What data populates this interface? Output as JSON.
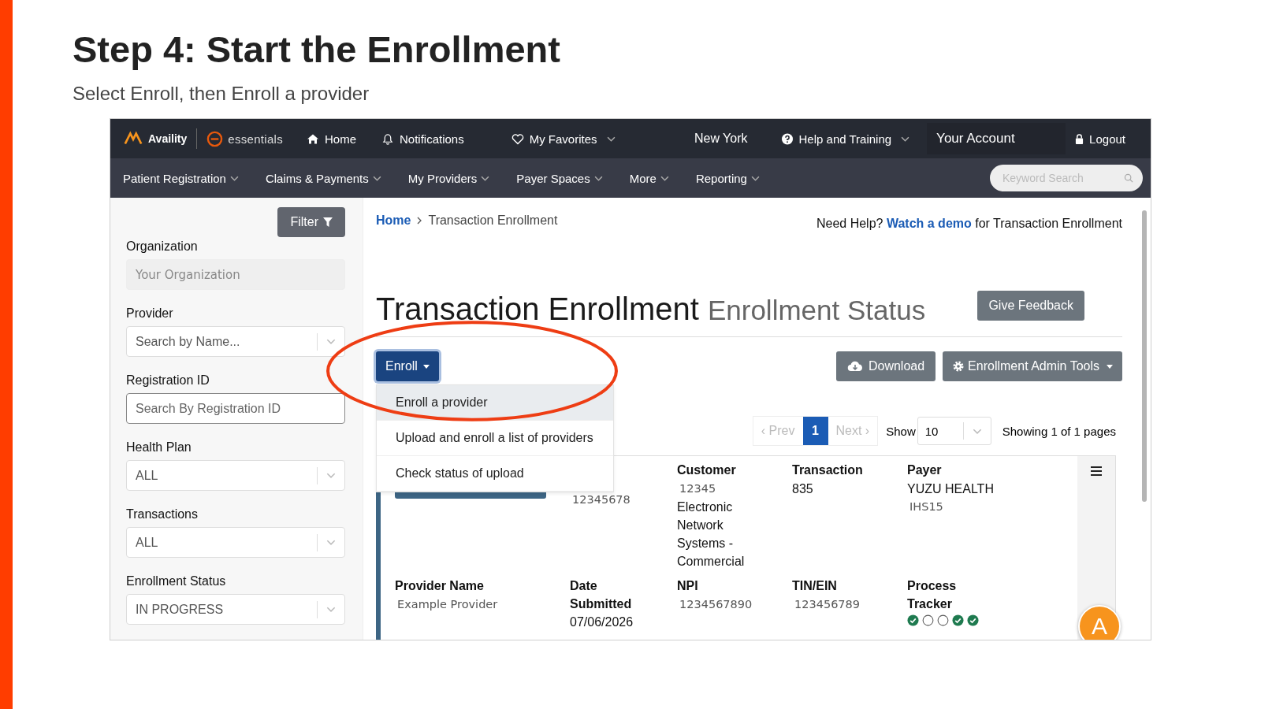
{
  "slide": {
    "title": "Step 4: Start the Enrollment",
    "subtitle": "Select Enroll, then Enroll a provider"
  },
  "topnav": {
    "brand": "Availity",
    "product": "essentials",
    "home": "Home",
    "notifications": "Notifications",
    "favorites": "My Favorites",
    "location": "New York",
    "help": "Help and Training",
    "account": "Your Account",
    "logout": "Logout"
  },
  "menu": {
    "items": [
      {
        "label": "Patient Registration"
      },
      {
        "label": "Claims & Payments"
      },
      {
        "label": "My Providers"
      },
      {
        "label": "Payer Spaces"
      },
      {
        "label": "More"
      },
      {
        "label": "Reporting"
      }
    ],
    "search_placeholder": "Keyword Search"
  },
  "sidebar": {
    "filter_button": "Filter",
    "fields": [
      {
        "label": "Organization",
        "kind": "readonly",
        "value": "Your Organization"
      },
      {
        "label": "Provider",
        "kind": "select",
        "placeholder": "Search by Name..."
      },
      {
        "label": "Registration ID",
        "kind": "input",
        "placeholder": "Search By Registration ID"
      },
      {
        "label": "Health Plan",
        "kind": "select",
        "value": "ALL"
      },
      {
        "label": "Transactions",
        "kind": "select",
        "value": "ALL"
      },
      {
        "label": "Enrollment Status",
        "kind": "select",
        "value": "IN PROGRESS"
      }
    ]
  },
  "breadcrumb": {
    "home": "Home",
    "current": "Transaction Enrollment"
  },
  "help": {
    "prefix": "Need Help?",
    "link": "Watch a demo",
    "suffix": "for Transaction Enrollment"
  },
  "heading": {
    "title": "Transaction Enrollment",
    "subtitle": "Enrollment Status",
    "feedback_button": "Give Feedback"
  },
  "enroll": {
    "button": "Enroll",
    "items": [
      {
        "label": "Enroll a provider",
        "highlighted": true
      },
      {
        "label": "Upload and enroll a list of providers",
        "highlighted": false
      },
      {
        "label": "Check status of upload",
        "highlighted": false
      }
    ]
  },
  "download_button": "Download",
  "admin_button": "Enrollment Admin Tools",
  "pagination": {
    "prev": "‹ Prev",
    "pages": [
      {
        "label": "1",
        "selected": true
      }
    ],
    "next": "Next ›",
    "show_label": "Show",
    "show_value": "10",
    "showing": "Showing 1 of 1 pages"
  },
  "card": {
    "row_1": [
      {
        "lines": [
          {
            "text": "12345678",
            "muted": true
          }
        ]
      },
      {
        "header": "Customer",
        "lines": [
          {
            "text": "12345",
            "muted": true
          },
          {
            "text": "Electronic Network Systems - Commercial",
            "muted": false
          }
        ]
      },
      {
        "header": "Transaction",
        "lines": [
          {
            "text": "835",
            "muted": false
          }
        ]
      },
      {
        "header": "Payer",
        "lines": [
          {
            "text": "YUZU HEALTH",
            "muted": false
          },
          {
            "text": "IHS15",
            "muted": true
          }
        ]
      }
    ],
    "row_2": [
      {
        "header": "Provider Name",
        "lines": [
          {
            "text": "Example Provider",
            "muted": true
          }
        ]
      },
      {
        "header": "Date Submitted",
        "lines": [
          {
            "text": "07/06/2026",
            "muted": false
          }
        ]
      },
      {
        "header": "NPI",
        "lines": [
          {
            "text": "1234567890",
            "muted": true
          }
        ]
      },
      {
        "header": "TIN/EIN",
        "lines": [
          {
            "text": "123456789",
            "muted": true
          }
        ]
      }
    ],
    "tracker": {
      "header": "Process Tracker",
      "steps": [
        {
          "completed": true
        },
        {
          "completed": false
        },
        {
          "completed": false
        },
        {
          "completed": true
        },
        {
          "completed": true
        }
      ]
    }
  },
  "chat": {
    "initial": "A"
  }
}
